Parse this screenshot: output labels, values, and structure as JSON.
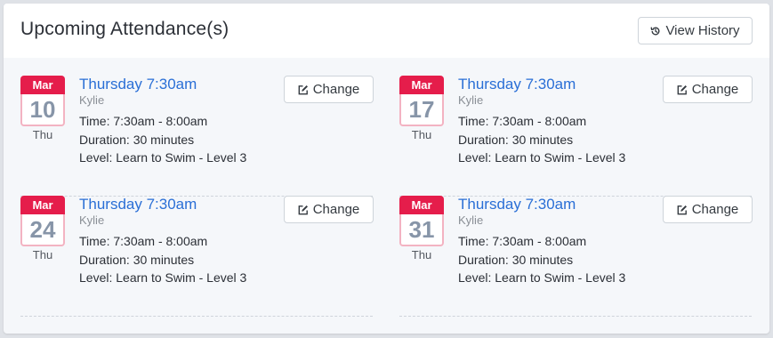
{
  "header": {
    "title": "Upcoming Attendance(s)",
    "history_label": "View History"
  },
  "entries": [
    {
      "month": "Mar",
      "day": "10",
      "weekday": "Thu",
      "title": "Thursday 7:30am",
      "name": "Kylie",
      "time": "Time: 7:30am - 8:00am",
      "duration": "Duration: 30 minutes",
      "level": "Level: Learn to Swim - Level 3",
      "change_label": "Change"
    },
    {
      "month": "Mar",
      "day": "17",
      "weekday": "Thu",
      "title": "Thursday 7:30am",
      "name": "Kylie",
      "time": "Time: 7:30am - 8:00am",
      "duration": "Duration: 30 minutes",
      "level": "Level: Learn to Swim - Level 3",
      "change_label": "Change"
    },
    {
      "month": "Mar",
      "day": "24",
      "weekday": "Thu",
      "title": "Thursday 7:30am",
      "name": "Kylie",
      "time": "Time: 7:30am - 8:00am",
      "duration": "Duration: 30 minutes",
      "level": "Level: Learn to Swim - Level 3",
      "change_label": "Change"
    },
    {
      "month": "Mar",
      "day": "31",
      "weekday": "Thu",
      "title": "Thursday 7:30am",
      "name": "Kylie",
      "time": "Time: 7:30am - 8:00am",
      "duration": "Duration: 30 minutes",
      "level": "Level: Learn to Swim - Level 3",
      "change_label": "Change"
    }
  ],
  "colors": {
    "calendar_month_bg": "#e51d4b",
    "calendar_border": "#f3b3c2",
    "calendar_day_text": "#8795a8",
    "link_blue": "#2a6fd6"
  },
  "icons": {
    "history": "history-icon",
    "change": "edit-icon"
  }
}
